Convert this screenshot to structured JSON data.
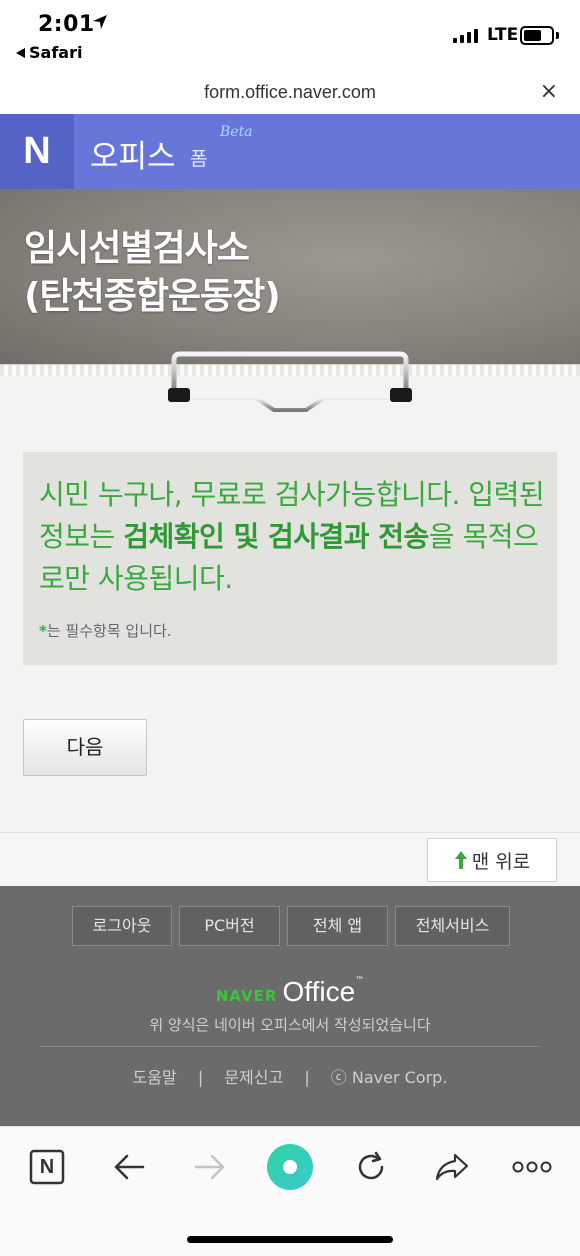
{
  "status_bar": {
    "time": "2:01",
    "back_app": "Safari",
    "network": "LTE"
  },
  "url_bar": {
    "url": "form.office.naver.com",
    "close_label": "×"
  },
  "header": {
    "logo": "N",
    "title": "오피스",
    "subtitle": "폼",
    "beta": "Beta"
  },
  "board": {
    "title_line1": "임시선별검사소",
    "title_line2": "(탄천종합운동장)"
  },
  "notice": {
    "part1": "시민 누구나, 무료로 검사가능합니다. 입력된 정보는 ",
    "bold": "검체확인 및 검사결과 전송",
    "part2": "을 목적으로만 사용됩니다.",
    "required_star": "*",
    "required_text": "는 필수항목 입니다."
  },
  "next_button": "다음",
  "top_button": "맨 위로",
  "footer": {
    "buttons": [
      "로그아웃",
      "PC버전",
      "전체 앱",
      "전체서비스"
    ],
    "brand_naver": "NAVER",
    "brand_office": "Office",
    "brand_tm": "™",
    "made_by": "위 양식은 네이버 오피스에서 작성되었습니다",
    "links": [
      "도움말",
      "문제신고",
      "ⓒ Naver Corp."
    ],
    "separator": "|"
  },
  "toolbar": {
    "home_label": "N"
  },
  "colors": {
    "header_bg": "#6976d9",
    "logo_bg": "#5563c7",
    "notice_green": "#39a83e",
    "footer_bg": "#6b6b6b"
  }
}
